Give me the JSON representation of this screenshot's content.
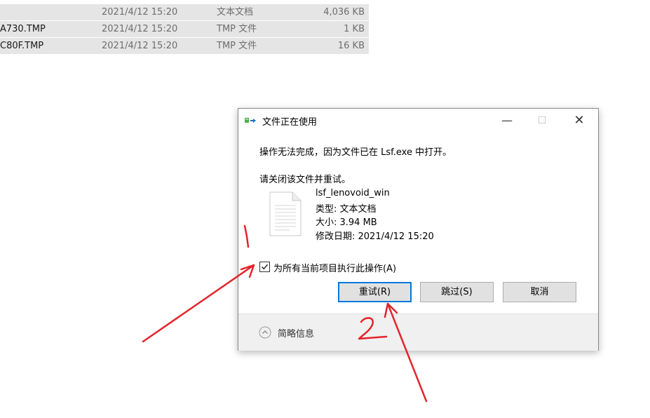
{
  "file_list": {
    "rows": [
      {
        "name": "",
        "date": "2021/4/12 15:20",
        "type": "文本文档",
        "size": "4,036 KB"
      },
      {
        "name": "A730.TMP",
        "date": "2021/4/12 15:20",
        "type": "TMP 文件",
        "size": "1 KB"
      },
      {
        "name": "C80F.TMP",
        "date": "2021/4/12 15:20",
        "type": "TMP 文件",
        "size": "16 KB"
      }
    ]
  },
  "dialog": {
    "title": "文件正在使用",
    "title_icon": "file-move-icon",
    "window_controls": {
      "minimize": "—",
      "maximize": "☐",
      "close": "✕"
    },
    "message": "操作无法完成，因为文件已在 Lsf.exe 中打开。",
    "instruction": "请关闭该文件并重试。",
    "file": {
      "icon": "text-document-icon",
      "name": "lsf_lenovoid_win",
      "type": "类型: 文本文档",
      "size": "大小: 3.94 MB",
      "modified": "修改日期: 2021/4/12 15:20"
    },
    "apply_all": {
      "label": "为所有当前项目执行此操作(A)",
      "checked": true
    },
    "buttons": {
      "retry": "重试(R)",
      "skip": "跳过(S)",
      "cancel": "取消"
    },
    "footer": {
      "label": "简略信息",
      "icon": "chevron-up-icon"
    }
  },
  "annotations": {
    "color": "#e3242b",
    "marks": [
      "1",
      "2"
    ]
  }
}
